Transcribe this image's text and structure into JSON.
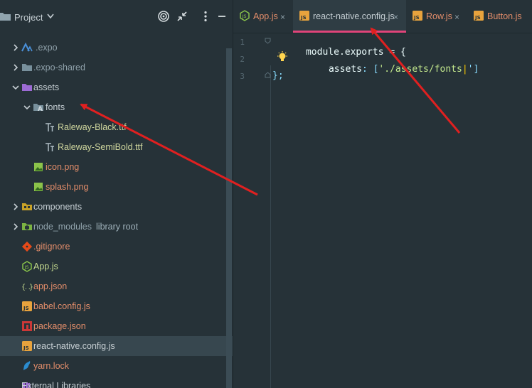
{
  "panel": {
    "title": "Project"
  },
  "tree": [
    {
      "label": "expo",
      "prefix": ".",
      "extra": "",
      "color": "#8fa1aa",
      "icon": "expo-folder-icon",
      "arrow": "right"
    },
    {
      "label": ".expo-shared",
      "extra": "",
      "color": "#8fa1aa",
      "icon": "folder-icon",
      "arrow": "right"
    },
    {
      "label": "assets",
      "extra": "",
      "color": "#c5ced3",
      "icon": "assets-folder-icon",
      "arrow": "down"
    },
    {
      "label": "fonts",
      "extra": "",
      "color": "#c5ced3",
      "icon": "fonts-folder-icon",
      "arrow": "down"
    },
    {
      "label": "Raleway-Black.ttf",
      "extra": "",
      "color": "#cfd69e",
      "icon": "font-file-icon",
      "arrow": ""
    },
    {
      "label": "Raleway-SemiBold.ttf",
      "extra": "",
      "color": "#cfd69e",
      "icon": "font-file-icon",
      "arrow": ""
    },
    {
      "label": "icon.png",
      "extra": "",
      "color": "#e38d6a",
      "icon": "image-file-icon",
      "arrow": ""
    },
    {
      "label": "splash.png",
      "extra": "",
      "color": "#e38d6a",
      "icon": "image-file-icon",
      "arrow": ""
    },
    {
      "label": "components",
      "extra": "",
      "color": "#c5ced3",
      "icon": "components-folder-icon",
      "arrow": "right"
    },
    {
      "label": "node_modules",
      "extra": "library root",
      "color": "#8fa1aa",
      "icon": "node-modules-folder-icon",
      "arrow": "right"
    },
    {
      "label": ".gitignore",
      "extra": "",
      "color": "#e38d6a",
      "icon": "git-icon",
      "arrow": ""
    },
    {
      "label": "App.js",
      "extra": "",
      "color": "#c3d88e",
      "icon": "nodejs-file-icon",
      "arrow": ""
    },
    {
      "label": "app.json",
      "extra": "",
      "color": "#e38d6a",
      "icon": "json-file-icon",
      "arrow": ""
    },
    {
      "label": "babel.config.js",
      "extra": "",
      "color": "#e38d6a",
      "icon": "js-file-icon",
      "arrow": ""
    },
    {
      "label": "package.json",
      "extra": "",
      "color": "#e38d6a",
      "icon": "npm-file-icon",
      "arrow": ""
    },
    {
      "label": "react-native.config.js",
      "extra": "",
      "color": "#c8d0d4",
      "icon": "js-file-icon",
      "arrow": ""
    },
    {
      "label": "yarn.lock",
      "extra": "",
      "color": "#e38d6a",
      "icon": "yarn-file-icon",
      "arrow": ""
    },
    {
      "label": "External Libraries",
      "extra": "",
      "color": "#c5ced3",
      "icon": "library-icon",
      "arrow": ""
    }
  ],
  "tabs": [
    {
      "label": "App.js",
      "color": "#e38d6a",
      "icon": "nodejs-file-icon"
    },
    {
      "label": "react-native.config.js",
      "color": "#c5ced3",
      "icon": "js-file-icon"
    },
    {
      "label": "Row.js",
      "color": "#e38d6a",
      "icon": "js-file-icon"
    },
    {
      "label": "Button.js",
      "color": "#e38d6a",
      "icon": "js-file-icon"
    }
  ],
  "close_glyph": "×",
  "code": {
    "line_numbers": [
      "1",
      "2",
      "3"
    ],
    "line1": {
      "a": "module",
      "b": ".exports = {"
    },
    "line2": {
      "key": "assets",
      "colon": ": [",
      "str": "'./assets/fonts",
      "caret": "|",
      "end": "']"
    },
    "line3": "};"
  },
  "colors": {
    "accent": "#e0457a",
    "arrow": "#e02020",
    "js_icon": "#e8a33d",
    "node_icon": "#8cc84b"
  }
}
